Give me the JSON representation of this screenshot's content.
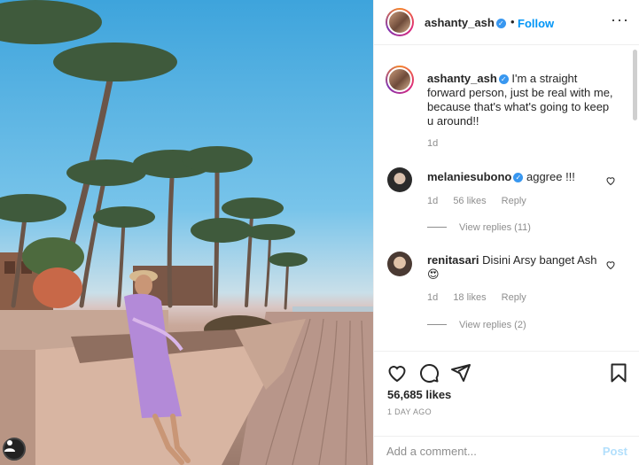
{
  "post": {
    "username": "ashanty_ash",
    "follow_label": "Follow",
    "dot": "•",
    "more_label": "···"
  },
  "caption": {
    "username": "ashanty_ash",
    "text": "I'm a straight forward person, just be real with me, because that's what's going to keep u around!!",
    "time": "1d"
  },
  "comments": [
    {
      "username": "melaniesubono",
      "verified": true,
      "text": "aggree !!!",
      "time": "1d",
      "likes": "56 likes",
      "reply_label": "Reply",
      "view_replies": "View replies (11)"
    },
    {
      "username": "renitasari",
      "verified": false,
      "text": "Disini Arsy banget Ash",
      "emoji": "😍",
      "time": "1d",
      "likes": "18 likes",
      "reply_label": "Reply",
      "view_replies": "View replies (2)"
    }
  ],
  "actions": {
    "likes": "56,685 likes",
    "timestamp": "1 DAY AGO",
    "icons": [
      "heart-icon",
      "comment-icon",
      "share-icon",
      "bookmark-icon"
    ]
  },
  "add_comment": {
    "placeholder": "Add a comment...",
    "post_label": "Post"
  },
  "colors": {
    "link_blue": "#0095f6",
    "verified_blue": "#3897f0",
    "muted": "#8e8e8e",
    "post_disabled": "#b2dffc"
  }
}
